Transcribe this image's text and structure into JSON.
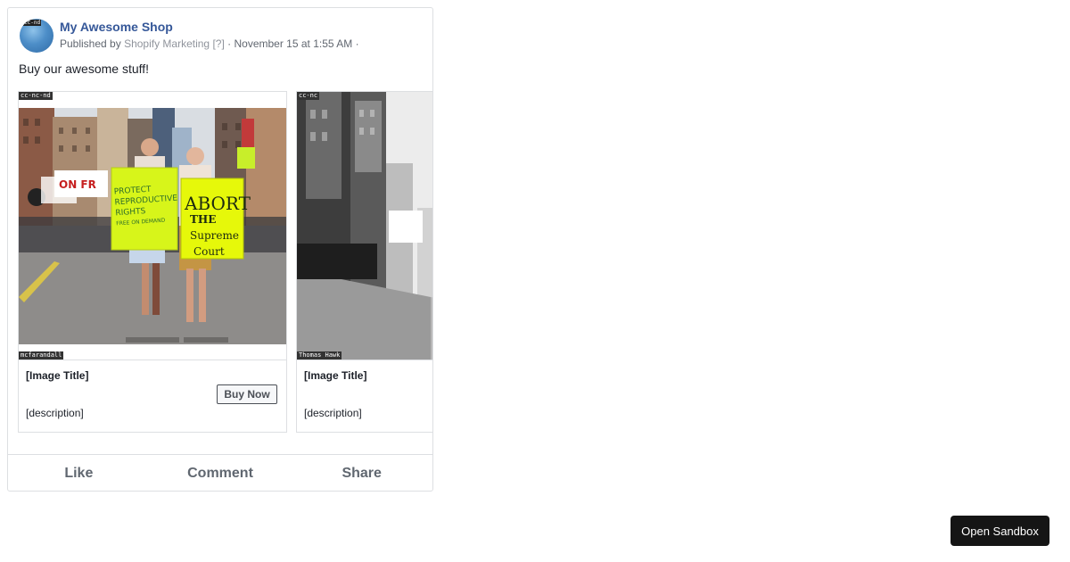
{
  "post": {
    "page_name": "My Awesome Shop",
    "published_by_prefix": "Published by",
    "publisher": "Shopify Marketing",
    "publisher_help": "[?]",
    "separator": "·",
    "timestamp": "November 15 at 1:55 AM",
    "trailing_separator": "·",
    "message": "Buy our awesome stuff!",
    "avatar_license": "cc-nd"
  },
  "carousel": {
    "cards": [
      {
        "license_tag": "cc-nc-nd",
        "credit": "mcfarandall",
        "title": "[Image Title]",
        "button_label": "Buy Now",
        "description": "[description]",
        "sign_1": [
          "PROTECT",
          "REPRODUCTIVE",
          "RIGHTS",
          "FREE ON DEMAND"
        ],
        "sign_2": [
          "ABORT",
          "THE",
          "Supreme",
          "Court"
        ]
      },
      {
        "license_tag": "cc-nc",
        "credit": "Thomas Hawk",
        "title": "[Image Title]",
        "description": "[description]"
      }
    ]
  },
  "actions": {
    "like": "Like",
    "comment": "Comment",
    "share": "Share"
  },
  "sandbox": {
    "label": "Open Sandbox"
  }
}
